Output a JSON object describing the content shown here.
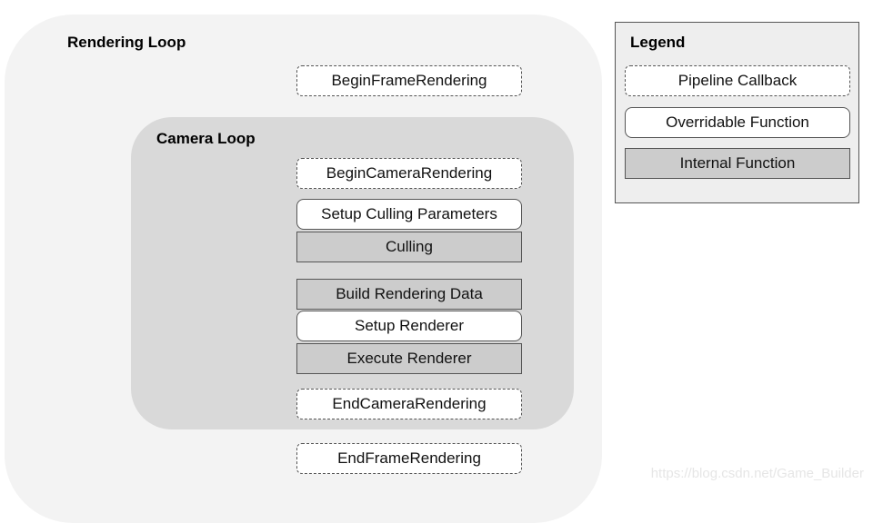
{
  "rendering_loop": {
    "title": "Rendering Loop",
    "begin": "BeginFrameRendering",
    "end": "EndFrameRendering"
  },
  "camera_loop": {
    "title": "Camera Loop",
    "steps": [
      {
        "label": "BeginCameraRendering",
        "kind": "callback"
      },
      {
        "label": "Setup Culling Parameters",
        "kind": "overridable"
      },
      {
        "label": "Culling",
        "kind": "internal"
      },
      {
        "label": "Build Rendering Data",
        "kind": "internal"
      },
      {
        "label": "Setup Renderer",
        "kind": "overridable"
      },
      {
        "label": "Execute Renderer",
        "kind": "internal"
      },
      {
        "label": "EndCameraRendering",
        "kind": "callback"
      }
    ]
  },
  "legend": {
    "title": "Legend",
    "items": [
      {
        "label": "Pipeline Callback",
        "kind": "callback"
      },
      {
        "label": "Overridable Function",
        "kind": "overridable"
      },
      {
        "label": "Internal Function",
        "kind": "internal"
      }
    ]
  },
  "watermark": "https://blog.csdn.net/Game_Builder"
}
